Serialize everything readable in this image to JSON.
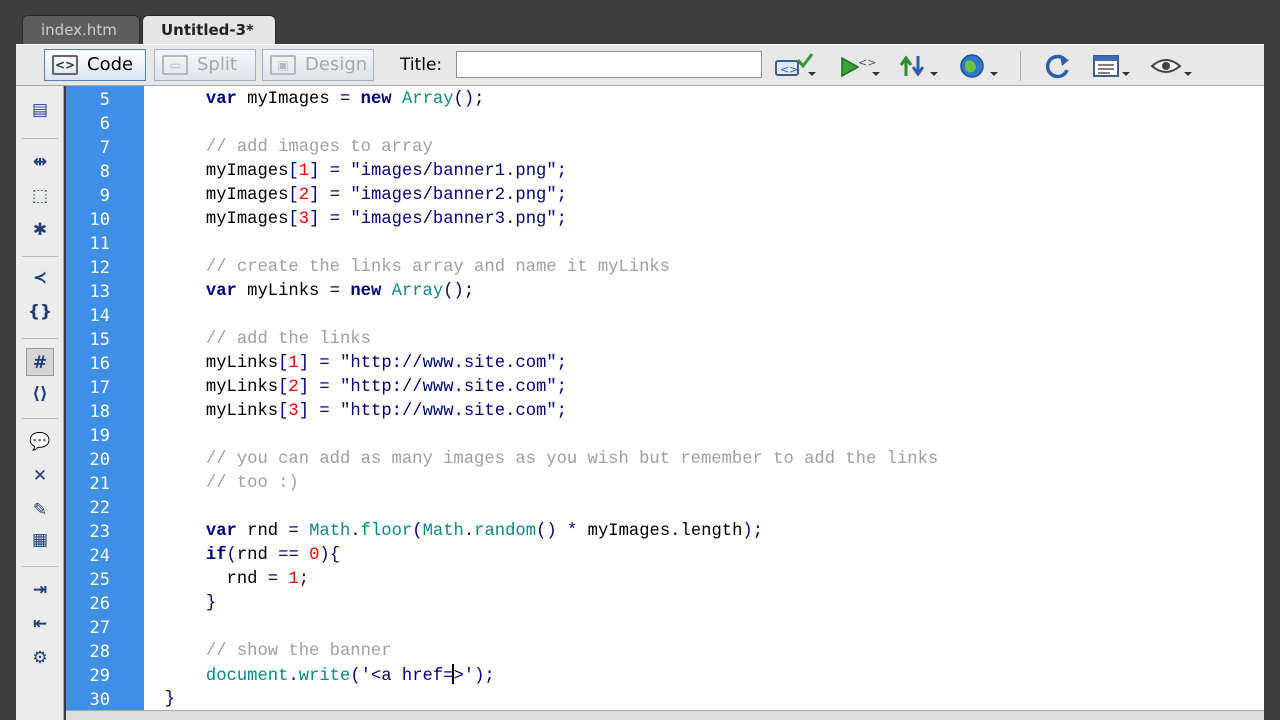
{
  "tabs": [
    {
      "label": "index.htm",
      "active": false
    },
    {
      "label": "Untitled-3*",
      "active": true
    }
  ],
  "toolbar": {
    "code_label": "Code",
    "split_label": "Split",
    "design_label": "Design",
    "title_label": "Title:",
    "title_value": "",
    "icons": [
      "validate-markup-icon",
      "preview-icon",
      "file-management-icon",
      "browser-check-icon",
      "refresh-icon",
      "view-options-icon",
      "visual-aids-icon"
    ]
  },
  "left_toolbar_icons": [
    "open-documents-icon",
    "collapse-full-tag-icon",
    "collapse-selection-icon",
    "expand-all-icon",
    "select-parent-tag-icon",
    "balance-braces-icon",
    "line-numbers-icon",
    "highlight-invalid-code-icon",
    "apply-comment-icon",
    "remove-comment-icon",
    "wrap-tag-icon",
    "recent-snippets-icon",
    "indent-code-icon",
    "outdent-code-icon",
    "format-source-icon"
  ],
  "colors": {
    "gutter": "#3f8fe8",
    "keyword": "#000080",
    "object": "#0a8a8a",
    "number": "#ff0000",
    "comment": "#a0a0a0"
  },
  "lines": [
    {
      "n": "5",
      "tokens": [
        [
          "sp",
          "      "
        ],
        [
          "kw",
          "var"
        ],
        [
          "id",
          " myImages "
        ],
        [
          "op",
          "="
        ],
        [
          "id",
          " "
        ],
        [
          "kw",
          "new"
        ],
        [
          "id",
          " "
        ],
        [
          "obj",
          "Array"
        ],
        [
          "op",
          "();"
        ]
      ]
    },
    {
      "n": "6",
      "tokens": []
    },
    {
      "n": "7",
      "tokens": [
        [
          "sp",
          "      "
        ],
        [
          "cmt",
          "// add images to array"
        ]
      ]
    },
    {
      "n": "8",
      "tokens": [
        [
          "sp",
          "      "
        ],
        [
          "id",
          "myImages"
        ],
        [
          "op",
          "["
        ],
        [
          "num",
          "1"
        ],
        [
          "op",
          "]"
        ],
        [
          "id",
          " "
        ],
        [
          "op",
          "="
        ],
        [
          "id",
          " "
        ],
        [
          "str",
          "\"images/banner1.png\""
        ],
        [
          "op",
          ";"
        ]
      ]
    },
    {
      "n": "9",
      "tokens": [
        [
          "sp",
          "      "
        ],
        [
          "id",
          "myImages"
        ],
        [
          "op",
          "["
        ],
        [
          "num",
          "2"
        ],
        [
          "op",
          "]"
        ],
        [
          "id",
          " "
        ],
        [
          "op",
          "="
        ],
        [
          "id",
          " "
        ],
        [
          "str",
          "\"images/banner2.png\""
        ],
        [
          "op",
          ";"
        ]
      ]
    },
    {
      "n": "10",
      "tokens": [
        [
          "sp",
          "      "
        ],
        [
          "id",
          "myImages"
        ],
        [
          "op",
          "["
        ],
        [
          "num",
          "3"
        ],
        [
          "op",
          "]"
        ],
        [
          "id",
          " "
        ],
        [
          "op",
          "="
        ],
        [
          "id",
          " "
        ],
        [
          "str",
          "\"images/banner3.png\""
        ],
        [
          "op",
          ";"
        ]
      ]
    },
    {
      "n": "11",
      "tokens": []
    },
    {
      "n": "12",
      "tokens": [
        [
          "sp",
          "      "
        ],
        [
          "cmt",
          "// create the links array and name it myLinks"
        ]
      ]
    },
    {
      "n": "13",
      "tokens": [
        [
          "sp",
          "      "
        ],
        [
          "kw",
          "var"
        ],
        [
          "id",
          " myLinks "
        ],
        [
          "op",
          "="
        ],
        [
          "id",
          " "
        ],
        [
          "kw",
          "new"
        ],
        [
          "id",
          " "
        ],
        [
          "obj",
          "Array"
        ],
        [
          "op",
          "();"
        ]
      ]
    },
    {
      "n": "14",
      "tokens": []
    },
    {
      "n": "15",
      "tokens": [
        [
          "sp",
          "      "
        ],
        [
          "cmt",
          "// add the links"
        ]
      ]
    },
    {
      "n": "16",
      "tokens": [
        [
          "sp",
          "      "
        ],
        [
          "id",
          "myLinks"
        ],
        [
          "op",
          "["
        ],
        [
          "num",
          "1"
        ],
        [
          "op",
          "]"
        ],
        [
          "id",
          " "
        ],
        [
          "op",
          "="
        ],
        [
          "id",
          " "
        ],
        [
          "str",
          "\"http://www.site.com\""
        ],
        [
          "op",
          ";"
        ]
      ]
    },
    {
      "n": "17",
      "tokens": [
        [
          "sp",
          "      "
        ],
        [
          "id",
          "myLinks"
        ],
        [
          "op",
          "["
        ],
        [
          "num",
          "2"
        ],
        [
          "op",
          "]"
        ],
        [
          "id",
          " "
        ],
        [
          "op",
          "="
        ],
        [
          "id",
          " "
        ],
        [
          "str",
          "\"http://www.site.com\""
        ],
        [
          "op",
          ";"
        ]
      ]
    },
    {
      "n": "18",
      "tokens": [
        [
          "sp",
          "      "
        ],
        [
          "id",
          "myLinks"
        ],
        [
          "op",
          "["
        ],
        [
          "num",
          "3"
        ],
        [
          "op",
          "]"
        ],
        [
          "id",
          " "
        ],
        [
          "op",
          "="
        ],
        [
          "id",
          " "
        ],
        [
          "str",
          "\"http://www.site.com\""
        ],
        [
          "op",
          ";"
        ]
      ]
    },
    {
      "n": "19",
      "tokens": []
    },
    {
      "n": "20",
      "tokens": [
        [
          "sp",
          "      "
        ],
        [
          "cmt",
          "// you can add as many images as you wish but remember to add the links"
        ]
      ]
    },
    {
      "n": "21",
      "tokens": [
        [
          "sp",
          "      "
        ],
        [
          "cmt",
          "// too :)"
        ]
      ]
    },
    {
      "n": "22",
      "tokens": []
    },
    {
      "n": "23",
      "tokens": [
        [
          "sp",
          "      "
        ],
        [
          "kw",
          "var"
        ],
        [
          "id",
          " rnd "
        ],
        [
          "op",
          "="
        ],
        [
          "id",
          " "
        ],
        [
          "obj",
          "Math"
        ],
        [
          "op",
          "."
        ],
        [
          "fn",
          "floor"
        ],
        [
          "op",
          "("
        ],
        [
          "obj",
          "Math"
        ],
        [
          "op",
          "."
        ],
        [
          "fn",
          "random"
        ],
        [
          "op",
          "()"
        ],
        [
          "id",
          " "
        ],
        [
          "op",
          "*"
        ],
        [
          "id",
          " myImages.length"
        ],
        [
          "op",
          ");"
        ]
      ]
    },
    {
      "n": "24",
      "tokens": [
        [
          "sp",
          "      "
        ],
        [
          "kw",
          "if"
        ],
        [
          "op",
          "("
        ],
        [
          "id",
          "rnd "
        ],
        [
          "op",
          "=="
        ],
        [
          "id",
          " "
        ],
        [
          "num",
          "0"
        ],
        [
          "op",
          "){"
        ]
      ]
    },
    {
      "n": "25",
      "tokens": [
        [
          "sp",
          "        "
        ],
        [
          "id",
          "rnd "
        ],
        [
          "op",
          "="
        ],
        [
          "id",
          " "
        ],
        [
          "num",
          "1"
        ],
        [
          "op",
          ";"
        ]
      ]
    },
    {
      "n": "26",
      "tokens": [
        [
          "sp",
          "      "
        ],
        [
          "op",
          "}"
        ]
      ]
    },
    {
      "n": "27",
      "tokens": []
    },
    {
      "n": "28",
      "tokens": [
        [
          "sp",
          "      "
        ],
        [
          "cmt",
          "// show the banner"
        ]
      ]
    },
    {
      "n": "29",
      "tokens": [
        [
          "sp",
          "      "
        ],
        [
          "fn",
          "document"
        ],
        [
          "op",
          "."
        ],
        [
          "fn",
          "write"
        ],
        [
          "op",
          "("
        ],
        [
          "str",
          "'<a href="
        ],
        [
          "caret",
          ""
        ],
        [
          "str",
          ">'"
        ],
        [
          "op",
          ");"
        ]
      ]
    },
    {
      "n": "30",
      "tokens": [
        [
          "sp",
          "  "
        ],
        [
          "op",
          "}"
        ]
      ]
    }
  ]
}
